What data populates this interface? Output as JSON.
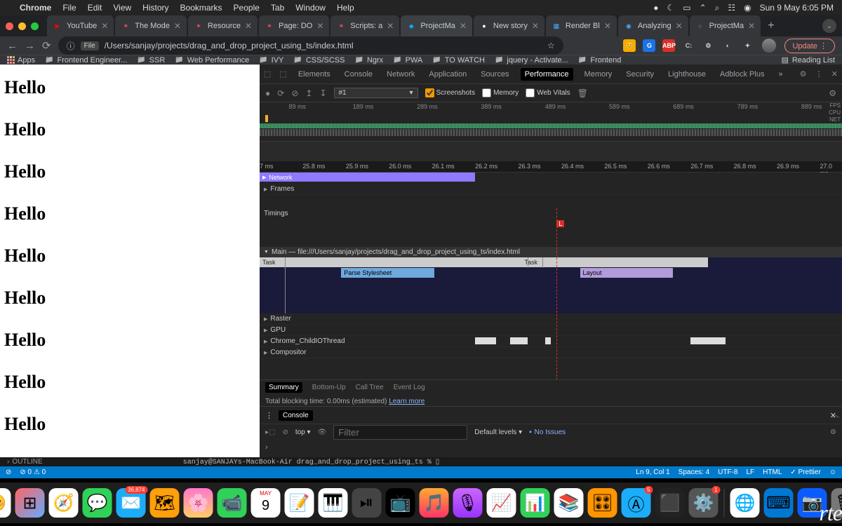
{
  "menubar": {
    "app": "Chrome",
    "items": [
      "File",
      "Edit",
      "View",
      "History",
      "Bookmarks",
      "People",
      "Tab",
      "Window",
      "Help"
    ],
    "clock": "Sun 9 May  6:05 PM"
  },
  "tabs": [
    {
      "favicon": "▶",
      "fc": "#f00",
      "label": "YouTube"
    },
    {
      "favicon": "✶",
      "fc": "#f55",
      "label": "The Mode"
    },
    {
      "favicon": "✶",
      "fc": "#f55",
      "label": "Resource"
    },
    {
      "favicon": "✶",
      "fc": "#f55",
      "label": "Page: DO"
    },
    {
      "favicon": "✶",
      "fc": "#f55",
      "label": "Scripts: a"
    },
    {
      "favicon": "◆",
      "fc": "#0af",
      "label": "ProjectMa",
      "active": true
    },
    {
      "favicon": "●",
      "fc": "#fff",
      "label": "New story"
    },
    {
      "favicon": "▦",
      "fc": "#4af",
      "label": "Render Bl"
    },
    {
      "favicon": "◉",
      "fc": "#4af",
      "label": "Analyzing"
    },
    {
      "favicon": "○",
      "fc": "#888",
      "label": "ProjectMa"
    }
  ],
  "url": {
    "info": "ⓘ",
    "file": "File",
    "path": "/Users/sanjay/projects/drag_and_drop_project_using_ts/index.html",
    "update": "Update"
  },
  "ext_icons": [
    {
      "bg": "#f9ab00",
      "txt": "😊"
    },
    {
      "bg": "#1a73e8",
      "txt": "G"
    },
    {
      "bg": "#d93025",
      "txt": "ABP"
    },
    {
      "bg": "",
      "txt": "C:"
    },
    {
      "bg": "",
      "txt": "⚙"
    },
    {
      "bg": "",
      "txt": "◐"
    },
    {
      "bg": "",
      "txt": "✦"
    }
  ],
  "bookmarks": {
    "apps": "Apps",
    "items": [
      "Frontend Engineer...",
      "SSR",
      "Web Performance",
      "IVY",
      "CSS/SCSS",
      "Ngrx",
      "PWA",
      "TO WATCH",
      "jquery - Activate...",
      "Frontend"
    ],
    "reading": "Reading List"
  },
  "page": {
    "heading": "Hello",
    "count": 9
  },
  "devtools": {
    "panels": [
      "Elements",
      "Console",
      "Network",
      "Application",
      "Sources",
      "Performance",
      "Memory",
      "Security",
      "Lighthouse",
      "Adblock Plus"
    ],
    "active_panel": "Performance",
    "more": "»",
    "perf_selector": "#1",
    "checks": {
      "screenshots": "Screenshots",
      "memory": "Memory",
      "webvitals": "Web Vitals"
    },
    "overview_ticks": [
      "89 ms",
      "189 ms",
      "289 ms",
      "389 ms",
      "489 ms",
      "589 ms",
      "689 ms",
      "789 ms",
      "889 ms"
    ],
    "overview_labels": [
      "FPS",
      "CPU",
      "NET"
    ],
    "ruler_ticks": [
      "7 ms",
      "25.8 ms",
      "25.9 ms",
      "26.0 ms",
      "26.1 ms",
      "26.2 ms",
      "26.3 ms",
      "26.4 ms",
      "26.5 ms",
      "26.6 ms",
      "26.7 ms",
      "26.8 ms",
      "26.9 ms",
      "27.0 ms"
    ],
    "tracks": {
      "network": "Network",
      "frames": "Frames",
      "timings": "Timings",
      "main": "Main — file:///Users/sanjay/projects/drag_and_drop_project_using_ts/index.html",
      "task": "Task",
      "parse": "Parse Stylesheet",
      "layout": "Layout",
      "raster": "Raster",
      "gpu": "GPU",
      "childio": "Chrome_ChildIOThread",
      "compositor": "Compositor"
    },
    "timings_badge": "L",
    "summary_tabs": [
      "Summary",
      "Bottom-Up",
      "Call Tree",
      "Event Log"
    ],
    "blocking_time": "Total blocking time: 0.00ms (estimated)",
    "learn_more": "Learn more",
    "console": {
      "label": "Console",
      "top": "top",
      "filter_placeholder": "Filter",
      "levels": "Default levels",
      "no_issues": "No Issues",
      "prompt": "›"
    }
  },
  "vscode": {
    "outline": "OUTLINE",
    "terminal": "sanjay@SANJAYs-MacBook-Air drag_and_drop_project_using_ts % ▯",
    "status_left": "⊘ 0 ⚠ 0",
    "status_right": [
      "Ln 9, Col 1",
      "Spaces: 4",
      "UTF-8",
      "LF",
      "HTML",
      "✓ Prettier"
    ]
  },
  "dock": {
    "icons": [
      {
        "bg": "#fff",
        "e": "😊"
      },
      {
        "bg": "linear-gradient(135deg,#f66,#6af)",
        "e": "⊞"
      },
      {
        "bg": "#fff",
        "e": "🧭"
      },
      {
        "bg": "#30d158",
        "e": "💬"
      },
      {
        "bg": "#1badf8",
        "e": "✉️",
        "badge": "36,874"
      },
      {
        "bg": "#ff9f0a",
        "e": "🗺"
      },
      {
        "bg": "linear-gradient(#f7c,#fc6)",
        "e": "🌸"
      },
      {
        "bg": "#30d158",
        "e": "📹"
      },
      {
        "bg": "#fff",
        "e": "9",
        "sub": "MAY"
      },
      {
        "bg": "#fff",
        "e": "📝"
      },
      {
        "bg": "#fff",
        "e": "🎹"
      },
      {
        "bg": "#444",
        "e": "⏯"
      },
      {
        "bg": "#000",
        "e": "📺"
      },
      {
        "bg": "linear-gradient(#fa3,#f36)",
        "e": "🎵"
      },
      {
        "bg": "linear-gradient(#c6f,#93f)",
        "e": "🎙"
      },
      {
        "bg": "#fff",
        "e": "📈"
      },
      {
        "bg": "#30d158",
        "e": "📊"
      },
      {
        "bg": "#fff",
        "e": "📚"
      },
      {
        "bg": "#ff9500",
        "e": "🎛"
      },
      {
        "bg": "#1badf8",
        "e": "Ⓐ",
        "badge": "5"
      },
      {
        "bg": "#222",
        "e": "⬛"
      },
      {
        "bg": "#555",
        "e": "⚙️",
        "badge": "1"
      },
      {
        "bg": "#fff",
        "e": "🌐",
        "chrome": true
      },
      {
        "bg": "#0078d4",
        "e": "⌨"
      },
      {
        "bg": "#0b5cff",
        "e": "📷"
      },
      {
        "bg": "#777",
        "e": "🗑"
      }
    ]
  }
}
